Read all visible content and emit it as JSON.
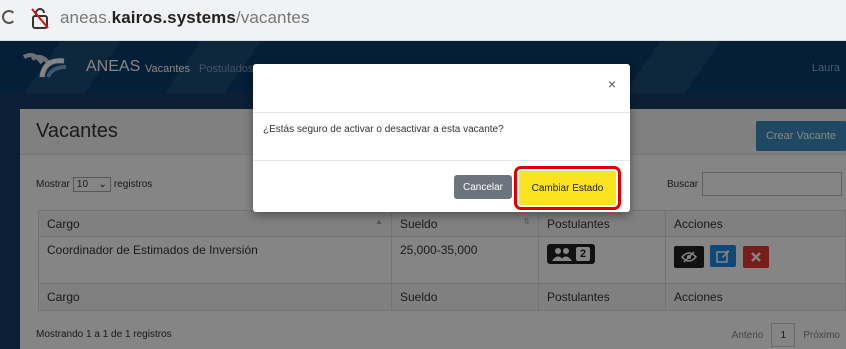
{
  "browser": {
    "url_host": "aneas.",
    "url_domain": "kairos.systems",
    "url_path": "/vacantes"
  },
  "navbar": {
    "brand": "ANEAS",
    "items": [
      {
        "label": "Vacantes",
        "active": true
      },
      {
        "label": "Postulados",
        "active": false
      }
    ],
    "user": "Laura"
  },
  "card": {
    "title": "Vacantes",
    "create_button": "Crear Vacante"
  },
  "controls": {
    "show_prefix": "Mostrar",
    "show_value": "10",
    "show_suffix": "registros",
    "search_label": "Buscar"
  },
  "table": {
    "headers": [
      "Cargo",
      "Sueldo",
      "Postulantes",
      "Acciones"
    ],
    "rows": [
      {
        "cargo": "Coordinador de Estimados de Inversión",
        "sueldo": "25,000-35,000",
        "postulantes": "2"
      }
    ],
    "footers": [
      "Cargo",
      "Sueldo",
      "Postulantes",
      "Acciones"
    ]
  },
  "footer": {
    "info": "Mostrando 1 a 1 de 1 registros",
    "prev": "Anterio",
    "page": "1",
    "next": "Próximo"
  },
  "modal": {
    "close": "×",
    "message": "¿Estás seguro de activar o desactivar a esta vacante?",
    "cancel_label": "Cancelar",
    "confirm_label": "Cambiar Estado"
  },
  "colors": {
    "navbar": "#0b3c6b",
    "primary": "#3c8dbc",
    "confirm": "#fae41f",
    "highlight": "#e00000",
    "edit": "#1e88e5",
    "delete": "#e53935"
  }
}
